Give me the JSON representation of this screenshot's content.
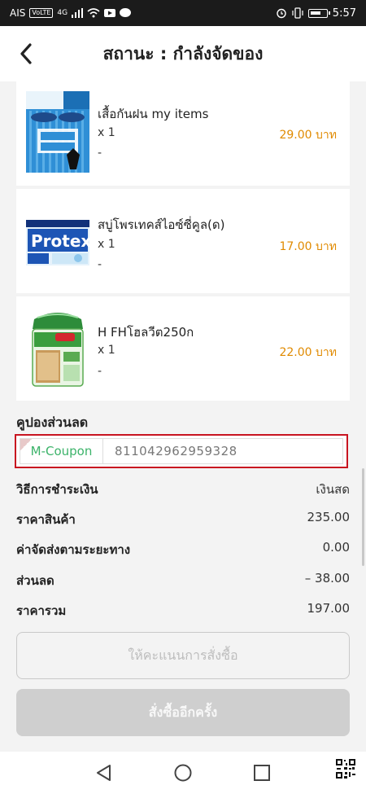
{
  "status_bar": {
    "carrier": "AIS",
    "volte": "VoLTE",
    "network": "4G",
    "time": "5:57"
  },
  "header": {
    "title": "สถานะ : กำลังจัดของ"
  },
  "items": [
    {
      "name": "เสื้อกันฝน my items",
      "qty": "x 1",
      "note": "-",
      "price": "29.00 บาท",
      "thumb": "raincoat-image"
    },
    {
      "name": "สบู่โพรเทคส์ไอซ์ซี่คูล(ด)",
      "qty": "x 1",
      "note": "-",
      "price": "17.00 บาท",
      "thumb": "protex-soap-image"
    },
    {
      "name": "H FHโฮลวีต250ก",
      "qty": "x 1",
      "note": "-",
      "price": "22.00 บาท",
      "thumb": "bread-image"
    }
  ],
  "coupon": {
    "section_title": "คูปองส่วนลด",
    "tag": "M-Coupon",
    "code": "811042962959328"
  },
  "summary": {
    "payment_label": "วิธีการชำระเงิน",
    "payment_value": "เงินสด",
    "subtotal_label": "ราคาสินค้า",
    "subtotal_value": "235.00",
    "shipping_label": "ค่าจัดส่งตามระยะทาง",
    "shipping_value": "0.00",
    "discount_label": "ส่วนลด",
    "discount_value": "– 38.00",
    "total_label": "ราคารวม",
    "total_value": "197.00"
  },
  "buttons": {
    "rate": "ให้คะแนนการสั่งซื้อ",
    "reorder": "สั่งซื้ออีกครั้ง"
  },
  "colors": {
    "price": "#e08a00",
    "coupon_border": "#c81420",
    "coupon_tag": "#3cb36a"
  }
}
